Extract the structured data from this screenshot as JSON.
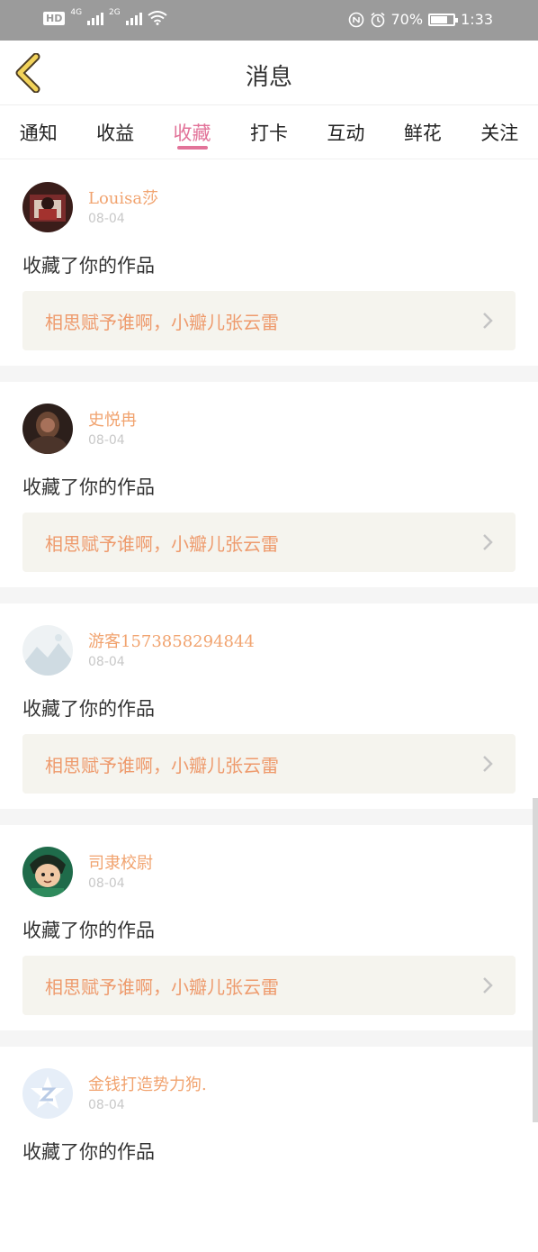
{
  "status_bar": {
    "network_badge": "HD",
    "net_4g": "4G",
    "net_2g": "2G",
    "battery_text": "70%",
    "time": "1:33"
  },
  "header": {
    "title": "消息"
  },
  "tabs": [
    {
      "label": "通知",
      "active": false
    },
    {
      "label": "收益",
      "active": false
    },
    {
      "label": "收藏",
      "active": true
    },
    {
      "label": "打卡",
      "active": false
    },
    {
      "label": "互动",
      "active": false
    },
    {
      "label": "鲜花",
      "active": false
    },
    {
      "label": "关注",
      "active": false
    }
  ],
  "items": [
    {
      "user": "Louisa莎",
      "date": "08-04",
      "action": "收藏了你的作品",
      "work": "相思赋予谁啊，小瓣儿张云雷",
      "avatar": "photo-dark"
    },
    {
      "user": "史悦冉",
      "date": "08-04",
      "action": "收藏了你的作品",
      "work": "相思赋予谁啊，小瓣儿张云雷",
      "avatar": "photo-brown"
    },
    {
      "user": "游客1573858294844",
      "date": "08-04",
      "action": "收藏了你的作品",
      "work": "相思赋予谁啊，小瓣儿张云雷",
      "avatar": "mountain-placeholder"
    },
    {
      "user": "司隶校尉",
      "date": "08-04",
      "action": "收藏了你的作品",
      "work": "相思赋予谁啊，小瓣儿张云雷",
      "avatar": "cartoon-hero"
    },
    {
      "user": "金钱打造势力狗.",
      "date": "08-04",
      "action": "收藏了你的作品",
      "work": "",
      "avatar": "z-logo"
    }
  ],
  "colors": {
    "accent": "#e27399",
    "username": "#f1a36f",
    "work_title": "#ee9a6c",
    "work_bg": "#f5f4ee",
    "back_arrow": "#f2d35a"
  }
}
